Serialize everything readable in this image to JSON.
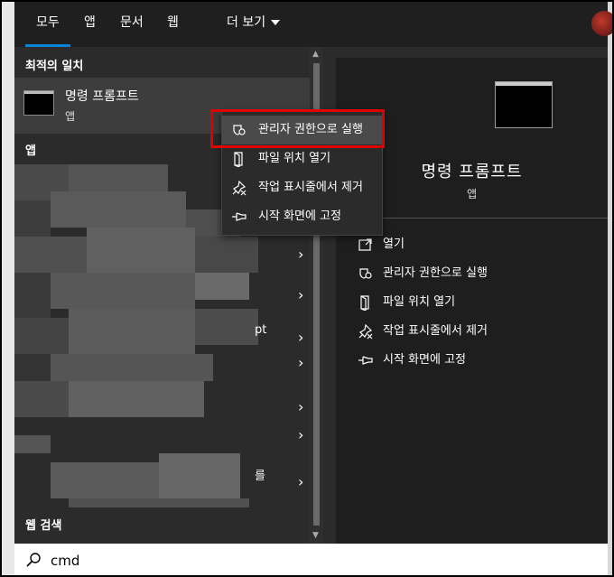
{
  "tabs": [
    {
      "label": "모두",
      "active": true
    },
    {
      "label": "앱"
    },
    {
      "label": "문서"
    },
    {
      "label": "웹"
    },
    {
      "label": "더 보기"
    }
  ],
  "left": {
    "best_match_header": "최적의 일치",
    "best_match": {
      "title": "명령 프롬프트",
      "subtitle": "앱"
    },
    "apps_header": "앱",
    "row_fragments": [
      "pt",
      "를"
    ],
    "web_header": "웹 검색"
  },
  "context_menu": [
    {
      "label": "관리자 권한으로 실행",
      "icon": "shield-icon"
    },
    {
      "label": "파일 위치 열기",
      "icon": "folder-icon"
    },
    {
      "label": "작업 표시줄에서 제거",
      "icon": "unpin-icon"
    },
    {
      "label": "시작 화면에 고정",
      "icon": "pin-icon"
    }
  ],
  "right_panel": {
    "title": "명령 프롬프트",
    "subtitle": "앱",
    "actions": [
      {
        "label": "열기",
        "icon": "open-icon"
      },
      {
        "label": "관리자 권한으로 실행",
        "icon": "shield-icon"
      },
      {
        "label": "파일 위치 열기",
        "icon": "folder-icon"
      },
      {
        "label": "작업 표시줄에서 제거",
        "icon": "unpin-icon"
      },
      {
        "label": "시작 화면에 고정",
        "icon": "pin-icon"
      }
    ]
  },
  "search": {
    "value": "cmd"
  },
  "colors": {
    "accent": "#0a84d6",
    "highlight_box": "#e00000",
    "panel": "#1e1e1e",
    "background": "#2b2b2b"
  }
}
